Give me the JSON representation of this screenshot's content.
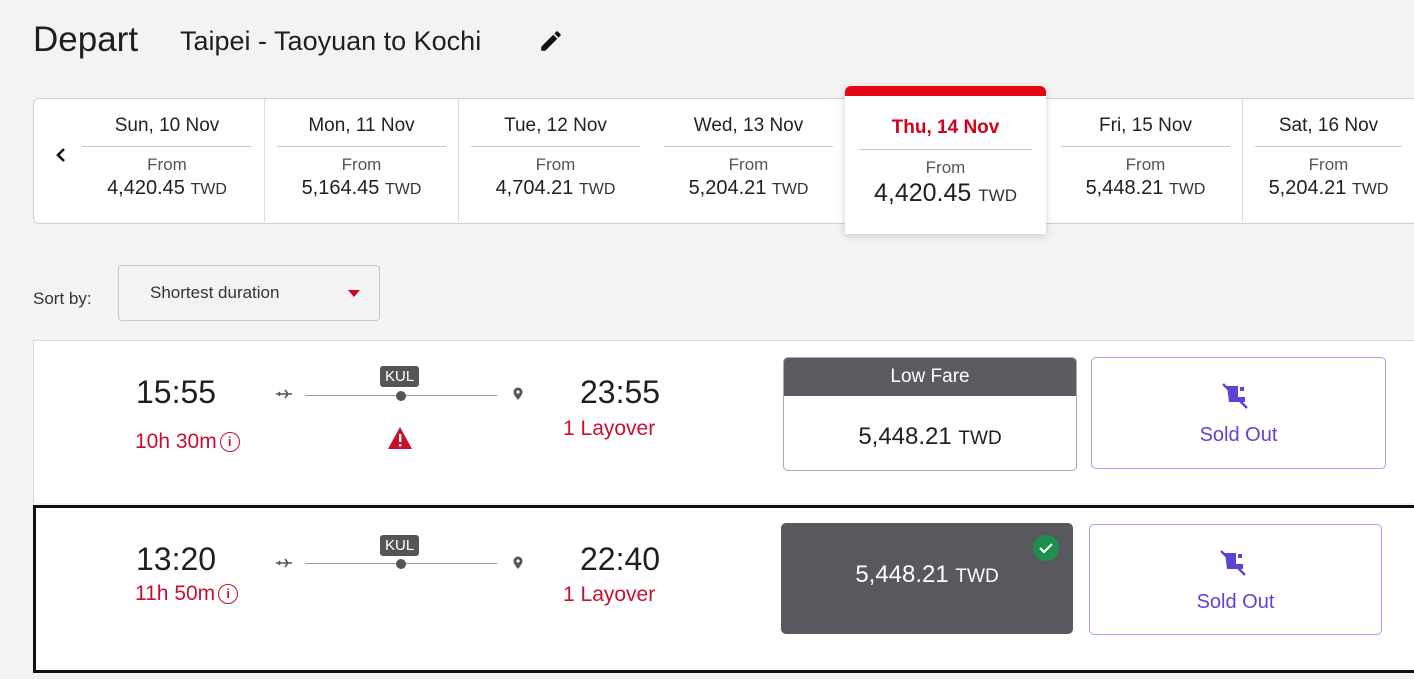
{
  "header": {
    "title": "Depart",
    "route": "Taipei - Taoyuan to Kochi",
    "edit_icon": "pencil-icon"
  },
  "dates": {
    "prev_icon": "chevron-left-icon",
    "items": [
      {
        "date": "Sun, 10 Nov",
        "from": "From",
        "price": "4,420.45",
        "currency": "TWD"
      },
      {
        "date": "Mon, 11 Nov",
        "from": "From",
        "price": "5,164.45",
        "currency": "TWD"
      },
      {
        "date": "Tue, 12 Nov",
        "from": "From",
        "price": "4,704.21",
        "currency": "TWD"
      },
      {
        "date": "Wed, 13 Nov",
        "from": "From",
        "price": "5,204.21",
        "currency": "TWD"
      },
      {
        "date": "Thu, 14 Nov",
        "from": "From",
        "price": "4,420.45",
        "currency": "TWD",
        "selected": true
      },
      {
        "date": "Fri, 15 Nov",
        "from": "From",
        "price": "5,448.21",
        "currency": "TWD"
      },
      {
        "date": "Sat, 16 Nov",
        "from": "From",
        "price": "5,204.21",
        "currency": "TWD"
      }
    ],
    "accent_color": "#e30613"
  },
  "sort": {
    "label": "Sort by:",
    "value": "Shortest duration"
  },
  "flights": [
    {
      "depart": "15:55",
      "duration": "10h 30m",
      "stop": "KUL",
      "arrive": "23:55",
      "layover": "1 Layover",
      "warning_icon": "warning-triangle-icon",
      "fare_label": "Low Fare",
      "fare_price": "5,448.21",
      "fare_currency": "TWD",
      "sold_out": "Sold Out"
    },
    {
      "depart": "13:20",
      "duration": "11h 50m",
      "stop": "KUL",
      "arrive": "22:40",
      "layover": "1 Layover",
      "fare_price": "5,448.21",
      "fare_currency": "TWD",
      "selected": true,
      "sold_out": "Sold Out"
    }
  ],
  "colors": {
    "alert_red": "#c8102e",
    "sold_out_purple": "#5a45d6",
    "selected_fare_bg": "#58595e",
    "check_green": "#1e8f4e"
  }
}
